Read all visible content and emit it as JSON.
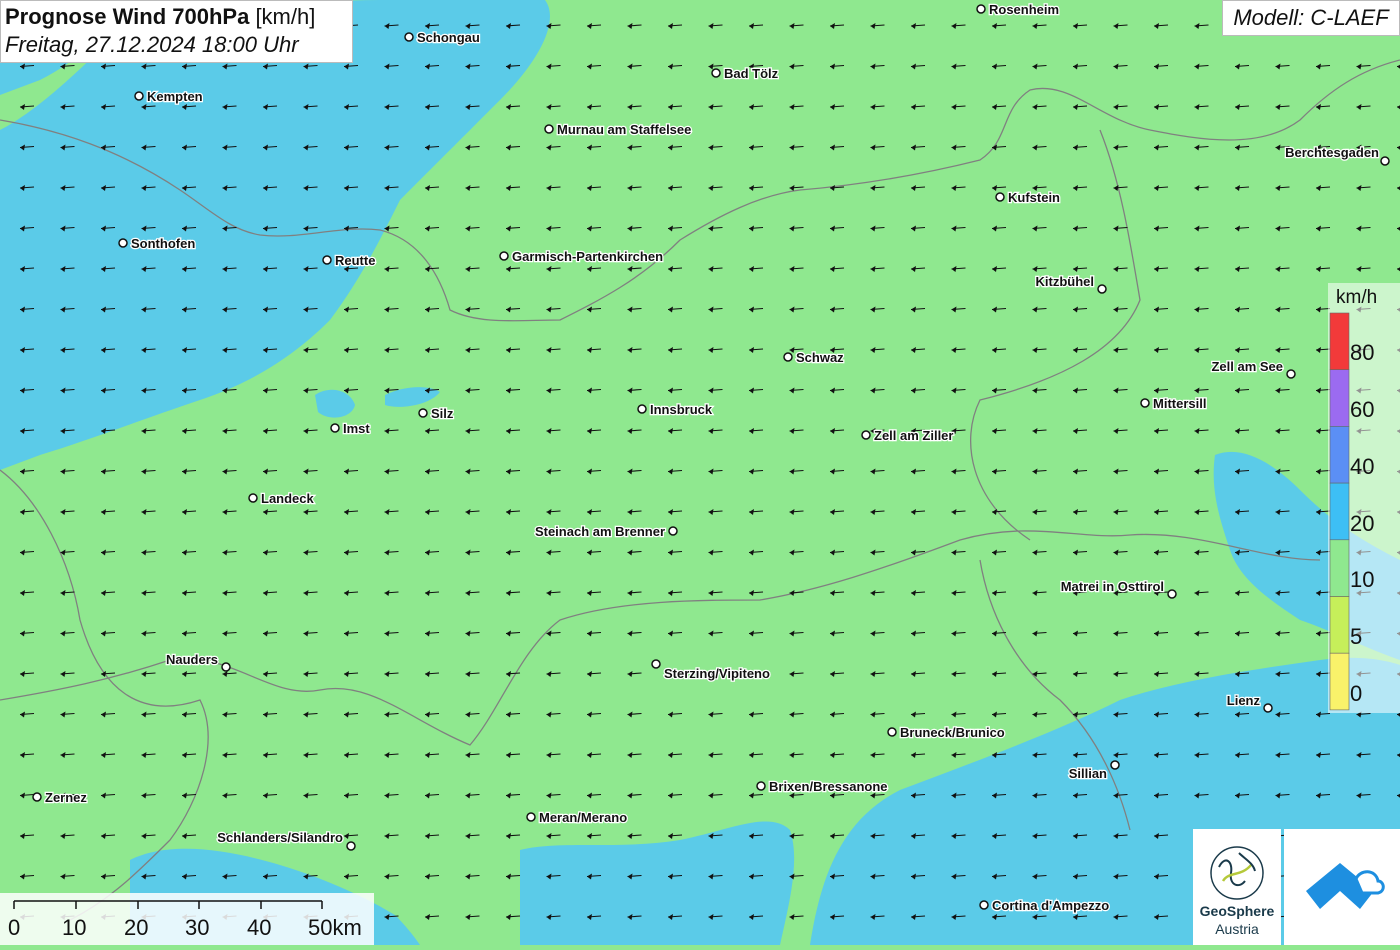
{
  "header": {
    "title_bold": "Prognose Wind 700hPa",
    "title_unit": "[km/h]",
    "datetime": "Freitag, 27.12.2024 18:00 Uhr"
  },
  "model_label": "Modell: C-LAEF",
  "legend": {
    "unit": "km/h",
    "labels": [
      "80",
      "60",
      "40",
      "20",
      "10",
      "5",
      "0"
    ],
    "colors": [
      "#f23a3a",
      "#9b6bf0",
      "#5b8ff5",
      "#3dbff5",
      "#8fe88f",
      "#c6ef5a",
      "#f9f26a"
    ]
  },
  "scale_bar": {
    "labels": [
      "0",
      "10",
      "20",
      "30",
      "40",
      "50km"
    ]
  },
  "logos": {
    "geosphere_line1": "GeoSphere",
    "geosphere_line2": "Austria"
  },
  "colors": {
    "land_calm": "#8fe88f",
    "wind_zone": "#55c8f2",
    "border": "#808080"
  },
  "cities": [
    {
      "name": "Rosenheim"
    },
    {
      "name": "Schongau"
    },
    {
      "name": "Bad Tölz"
    },
    {
      "name": "Kempten"
    },
    {
      "name": "Murnau am Staffelsee"
    },
    {
      "name": "Berchtesgaden"
    },
    {
      "name": "Kufstein"
    },
    {
      "name": "Sonthofen"
    },
    {
      "name": "Reutte"
    },
    {
      "name": "Garmisch-Partenkirchen"
    },
    {
      "name": "Kitzbühel"
    },
    {
      "name": "Schwaz"
    },
    {
      "name": "Zell am See"
    },
    {
      "name": "Mittersill"
    },
    {
      "name": "Silz"
    },
    {
      "name": "Innsbruck"
    },
    {
      "name": "Imst"
    },
    {
      "name": "Zell am Ziller"
    },
    {
      "name": "Landeck"
    },
    {
      "name": "Steinach am Brenner"
    },
    {
      "name": "Matrei in Osttirol"
    },
    {
      "name": "Nauders"
    },
    {
      "name": "Sterzing/Vipiteno"
    },
    {
      "name": "Lienz"
    },
    {
      "name": "Bruneck/Brunico"
    },
    {
      "name": "Sillian"
    },
    {
      "name": "Zernez"
    },
    {
      "name": "Brixen/Bressanone"
    },
    {
      "name": "Meran/Merano"
    },
    {
      "name": "Schlanders/Silandro"
    },
    {
      "name": "Cortina d'Ampezzo"
    }
  ]
}
